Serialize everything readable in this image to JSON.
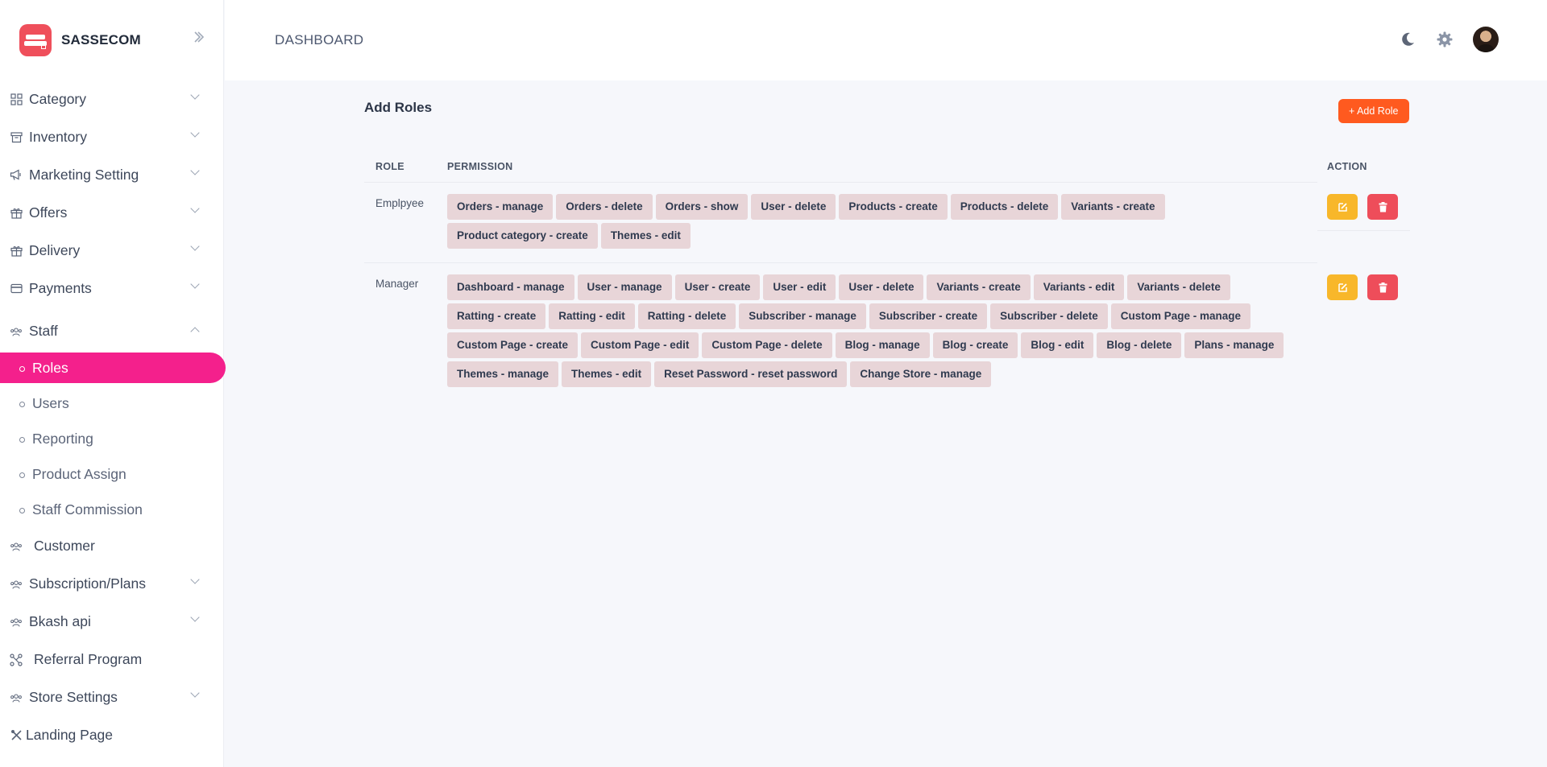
{
  "brand": {
    "name": "SASSECOM"
  },
  "header": {
    "title": "DASHBOARD"
  },
  "sidebar": {
    "items": [
      {
        "label": "Category",
        "icon": "grid-icon",
        "expandable": true
      },
      {
        "label": "Inventory",
        "icon": "archive-icon",
        "expandable": true
      },
      {
        "label": "Marketing Setting",
        "icon": "megaphone-icon",
        "expandable": true
      },
      {
        "label": "Offers",
        "icon": "gift-icon",
        "expandable": true
      },
      {
        "label": "Delivery",
        "icon": "gift-icon",
        "expandable": true
      },
      {
        "label": "Payments",
        "icon": "credit-card-icon",
        "expandable": true
      },
      {
        "label": "Staff",
        "icon": "users-icon",
        "expanded": true
      }
    ],
    "staff_sub": [
      {
        "label": "Roles",
        "active": true
      },
      {
        "label": "Users"
      },
      {
        "label": "Reporting"
      },
      {
        "label": "Product Assign"
      },
      {
        "label": "Staff Commission"
      }
    ],
    "items_after": [
      {
        "label": "Customer",
        "icon": "users-icon"
      },
      {
        "label": "Subscription/Plans",
        "icon": "users-icon",
        "expandable": true
      },
      {
        "label": "Bkash api",
        "icon": "users-icon",
        "expandable": true
      },
      {
        "label": "Referral Program",
        "icon": "network-icon"
      },
      {
        "label": "Store Settings",
        "icon": "users-icon",
        "expandable": true
      },
      {
        "label": "Landing Page",
        "icon": "tools-icon"
      }
    ]
  },
  "main": {
    "title": "Add Roles",
    "add_button": "+ Add Role",
    "columns": {
      "role": "ROLE",
      "permission": "PERMISSION",
      "action": "ACTION"
    },
    "rows": [
      {
        "role": "Emplpyee",
        "permissions": [
          "Orders - manage",
          "Orders - delete",
          "Orders - show",
          "User - delete",
          "Products - create",
          "Products - delete",
          "Variants - create",
          "Product category - create",
          "Themes - edit"
        ]
      },
      {
        "role": "Manager",
        "permissions": [
          "Dashboard - manage",
          "User - manage",
          "User - create",
          "User - edit",
          "User - delete",
          "Variants - create",
          "Variants - edit",
          "Variants - delete",
          "Ratting - create",
          "Ratting - edit",
          "Ratting - delete",
          "Subscriber - manage",
          "Subscriber - create",
          "Subscriber - delete",
          "Custom Page - manage",
          "Custom Page - create",
          "Custom Page - edit",
          "Custom Page - delete",
          "Blog - manage",
          "Blog - create",
          "Blog - edit",
          "Blog - delete",
          "Plans - manage",
          "Themes - manage",
          "Themes - edit",
          "Reset Password - reset password",
          "Change Store - manage"
        ]
      }
    ]
  },
  "colors": {
    "accent": "#f4208c",
    "add_button": "#ff5a1f",
    "edit": "#f8b72a",
    "delete": "#ee4d5a",
    "chip": "#e8d5d8"
  }
}
